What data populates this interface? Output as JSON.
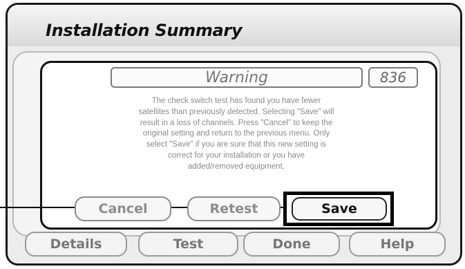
{
  "window": {
    "title": "Installation Summary"
  },
  "dialog": {
    "header": "Warning",
    "code": "836",
    "message_lines": [
      "The check switch test has found you have fewer",
      "satellites than previously detected. Selecting \"Save\" will",
      "result in a loss of channels.  Press \"Cancel\" to keep the",
      "original setting and return to the previous menu.  Only",
      "select \"Save\" if you are sure that this new setting is",
      "correct for your installation or you have",
      "added/removed equipment."
    ],
    "buttons": {
      "cancel": "Cancel",
      "retest": "Retest",
      "save": "Save"
    }
  },
  "footer": {
    "details": "Details",
    "test": "Test",
    "done": "Done",
    "help": "Help"
  }
}
